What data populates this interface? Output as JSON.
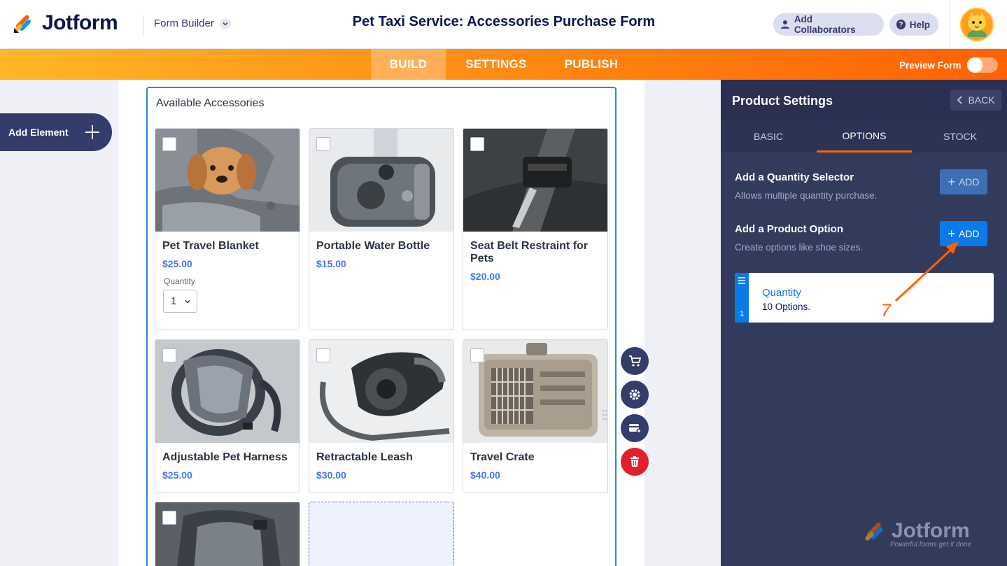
{
  "header": {
    "brand": "Jotform",
    "builder_label": "Form Builder",
    "form_title": "Pet Taxi Service: Accessories Purchase Form",
    "collab_label": "Add Collaborators",
    "help_label": "Help"
  },
  "nav": {
    "tabs": [
      "BUILD",
      "SETTINGS",
      "PUBLISH"
    ],
    "active": "BUILD",
    "preview_label": "Preview Form",
    "preview_on": false
  },
  "left": {
    "add_element_label": "Add Element"
  },
  "canvas": {
    "field_label": "Available Accessories",
    "quantity_label": "Quantity",
    "quantity_value": "1",
    "products": [
      {
        "name": "Pet Travel Blanket",
        "price": "$25.00"
      },
      {
        "name": "Portable Water Bottle",
        "price": "$15.00"
      },
      {
        "name": "Seat Belt Restraint for Pets",
        "price": "$20.00"
      },
      {
        "name": "Adjustable Pet Harness",
        "price": "$25.00"
      },
      {
        "name": "Retractable Leash",
        "price": "$30.00"
      },
      {
        "name": "Travel Crate",
        "price": "$40.00"
      }
    ]
  },
  "panel": {
    "title": "Product Settings",
    "back_label": "BACK",
    "tabs": [
      "BASIC",
      "OPTIONS",
      "STOCK"
    ],
    "active_tab": "OPTIONS",
    "quantity_selector": {
      "title": "Add a Quantity Selector",
      "desc": "Allows multiple quantity purchase.",
      "button": "ADD"
    },
    "product_option": {
      "title": "Add a Product Option",
      "desc": "Create options like shoe sizes.",
      "button": "ADD"
    },
    "option_item": {
      "index": "1",
      "name": "Quantity",
      "count": "10 Options."
    },
    "annotation_step": "7",
    "watermark": {
      "brand": "Jotform",
      "tagline": "Powerful forms get it done"
    }
  },
  "colors": {
    "accent_orange": "#ff6100",
    "primary_blue": "#0a7ae8",
    "navy": "#343c6a",
    "price_blue": "#4277f2",
    "delete_red": "#e0202a"
  }
}
